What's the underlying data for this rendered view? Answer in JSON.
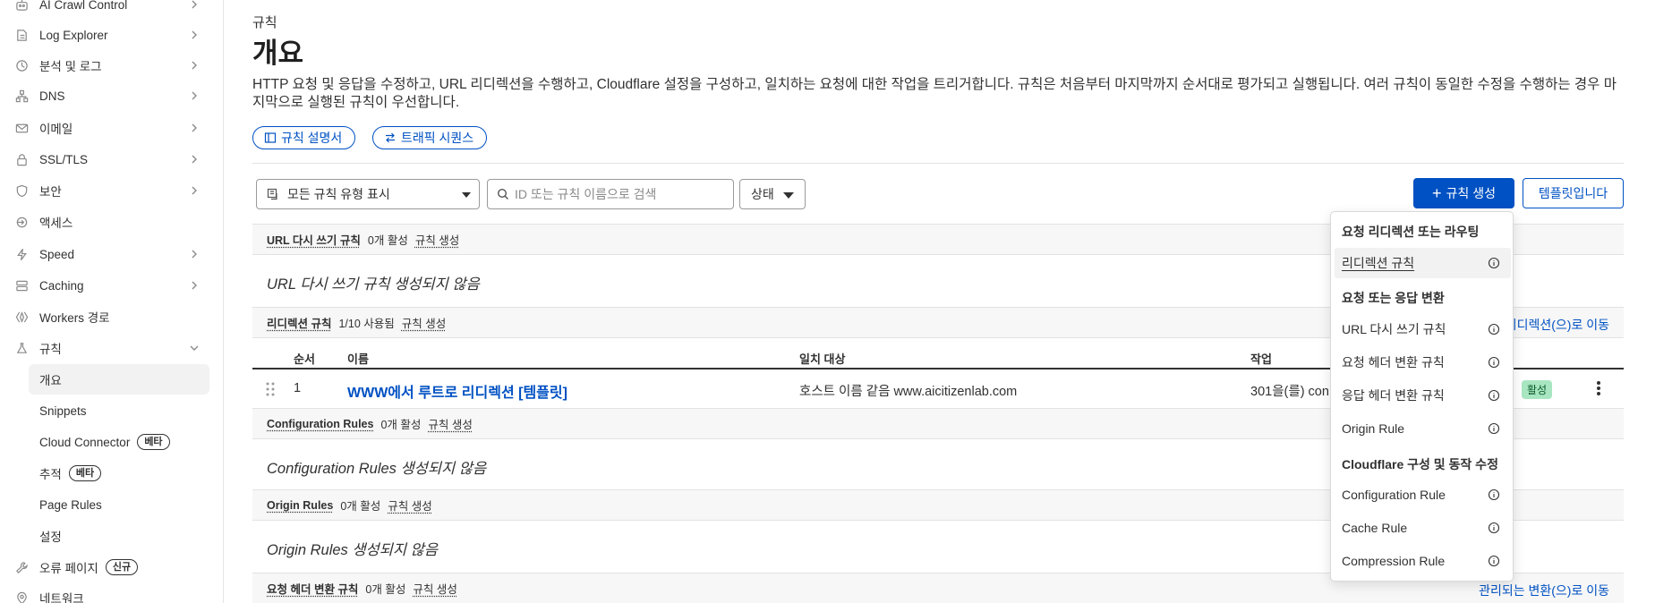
{
  "sidebar": {
    "items": [
      {
        "label": "AI Crawl Control",
        "icon": "robot-icon",
        "chevron": true
      },
      {
        "label": "Log Explorer",
        "icon": "log-icon",
        "chevron": true
      },
      {
        "label": "분석 및 로그",
        "icon": "clock-icon",
        "chevron": true
      },
      {
        "label": "DNS",
        "icon": "network-icon",
        "chevron": true
      },
      {
        "label": "이메일",
        "icon": "mail-icon",
        "chevron": true
      },
      {
        "label": "SSL/TLS",
        "icon": "lock-icon",
        "chevron": true
      },
      {
        "label": "보안",
        "icon": "shield-icon",
        "chevron": true
      },
      {
        "label": "액세스",
        "icon": "access-icon",
        "chevron": false
      },
      {
        "label": "Speed",
        "icon": "bolt-icon",
        "chevron": true
      },
      {
        "label": "Caching",
        "icon": "database-icon",
        "chevron": true
      },
      {
        "label": "Workers 경로",
        "icon": "workers-icon",
        "chevron": false
      },
      {
        "label": "규칙",
        "icon": "rules-icon",
        "chevron": true
      }
    ],
    "rules_sub": [
      {
        "label": "개요",
        "active": true
      },
      {
        "label": "Snippets"
      },
      {
        "label": "Cloud Connector",
        "badge": "베타"
      },
      {
        "label": "추적",
        "badge": "베타"
      },
      {
        "label": "Page Rules"
      },
      {
        "label": "설정"
      }
    ],
    "bottom_items": [
      {
        "label": "오류 페이지",
        "icon": "wrench-icon",
        "badge": "신규"
      },
      {
        "label": "네트워크",
        "icon": "location-icon"
      }
    ]
  },
  "page": {
    "breadcrumb": "규칙",
    "title": "개요",
    "description": "HTTP 요청 및 응답을 수정하고, URL 리디렉션을 수행하고, Cloudflare 설정을 구성하고, 일치하는 요청에 대한 작업을 트리거합니다. 규칙은 처음부터 마지막까지 순서대로 평가되고 실행됩니다. 여러 규칙이 동일한 수정을 수행하는 경우 마지막으로 실행된 규칙이 우선합니다.",
    "doc_button": "규칙 설명서",
    "trace_button": "트래픽 시퀀스"
  },
  "toolbar": {
    "type_select": "모든 규칙 유형 표시",
    "search_placeholder": "ID 또는 규칙 이름으로 검색",
    "status_select": "상태",
    "create_button": "규칙 생성",
    "create_plus": "+",
    "templates_button": "템플릿입니다"
  },
  "sections": [
    {
      "name": "URL 다시 쓰기 규칙",
      "count": "0개 활성",
      "link": "규칙 생성",
      "empty": "URL 다시 쓰기 규칙 생성되지 않음"
    },
    {
      "name": "리디렉션 규칙",
      "count": "1/10 사용됨",
      "link": "규칙 생성",
      "right_link": "리디렉션(으)로 이동"
    },
    {
      "name": "Configuration Rules",
      "count": "0개 활성",
      "link": "규칙 생성",
      "empty": "Configuration Rules 생성되지 않음"
    },
    {
      "name": "Origin Rules",
      "count": "0개 활성",
      "link": "규칙 생성",
      "empty": "Origin Rules 생성되지 않음"
    },
    {
      "name": "요청 헤더 변환 규칙",
      "count": "0개 활성",
      "link": "규칙 생성",
      "right_link": "관리되는 변환(으)로 이동"
    }
  ],
  "table": {
    "columns": [
      "순서",
      "이름",
      "일치 대상",
      "작업"
    ],
    "rows": [
      {
        "order": "1",
        "name": "WWW에서 루트로 리디렉션 [템플릿]",
        "match": "호스트 이름 같음 www.aicitizenlab.com",
        "action": "301을(를) con",
        "status": "활성"
      }
    ]
  },
  "dropdown": {
    "groups": [
      {
        "heading": "요청 리디렉션 또는 라우팅",
        "items": [
          "리디렉션 규칙"
        ]
      },
      {
        "heading": "요청 또는 응답 변환",
        "items": [
          "URL 다시 쓰기 규칙",
          "요청 헤더 변환 규칙",
          "응답 헤더 변환 규칙",
          "Origin Rule"
        ]
      },
      {
        "heading": "Cloudflare 구성 및 동작 수정",
        "items": [
          "Configuration Rule",
          "Cache Rule",
          "Compression Rule"
        ]
      }
    ]
  },
  "colors": {
    "accent": "#0051c3",
    "active_badge_bg": "#a8e6c1",
    "active_badge_text": "#0b5b2c"
  }
}
